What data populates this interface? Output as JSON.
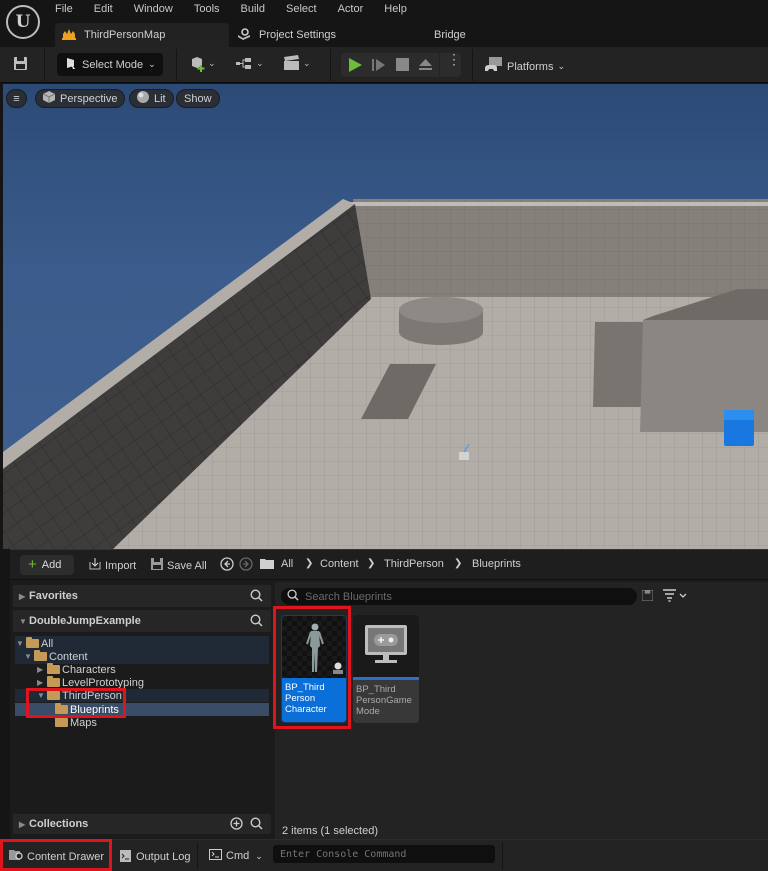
{
  "app": {
    "logo": "U"
  },
  "menu": [
    "File",
    "Edit",
    "Window",
    "Tools",
    "Build",
    "Select",
    "Actor",
    "Help"
  ],
  "tabs": [
    {
      "label": "ThirdPersonMap",
      "icon": "level-icon",
      "active": true
    },
    {
      "label": "Project Settings",
      "icon": "settings-icon",
      "active": false
    },
    {
      "label": "Bridge",
      "icon": "",
      "active": false
    }
  ],
  "toolbar": {
    "select_mode": "Select Mode",
    "platforms": "Platforms"
  },
  "viewport": {
    "menu_icon": "hamburger-icon",
    "perspective": "Perspective",
    "lit": "Lit",
    "show": "Show"
  },
  "content_drawer": {
    "add": "Add",
    "import": "Import",
    "save_all": "Save All",
    "breadcrumb": [
      "All",
      "Content",
      "ThirdPerson",
      "Blueprints"
    ],
    "favorites": "Favorites",
    "project": "DoubleJumpExample",
    "tree": [
      {
        "label": "All",
        "depth": 0,
        "expanded": true
      },
      {
        "label": "Content",
        "depth": 1,
        "expanded": true
      },
      {
        "label": "Characters",
        "depth": 2,
        "expanded": false
      },
      {
        "label": "LevelPrototyping",
        "depth": 2,
        "expanded": false
      },
      {
        "label": "ThirdPerson",
        "depth": 2,
        "expanded": true
      },
      {
        "label": "Blueprints",
        "depth": 3,
        "selected": true
      },
      {
        "label": "Maps",
        "depth": 3
      }
    ],
    "collections": "Collections",
    "search_placeholder": "Search Blueprints",
    "assets": [
      {
        "label": "BP_Third Person Character",
        "selected": true
      },
      {
        "label": "BP_Third PersonGame Mode",
        "selected": false
      }
    ],
    "status": "2 items (1 selected)"
  },
  "bottom_bar": {
    "content_drawer": "Content Drawer",
    "output_log": "Output Log",
    "cmd": "Cmd",
    "console_placeholder": "Enter Console Command"
  },
  "colors": {
    "accent": "#0a6fd8",
    "highlight": "#e0141c",
    "play": "#6cbd3a"
  }
}
